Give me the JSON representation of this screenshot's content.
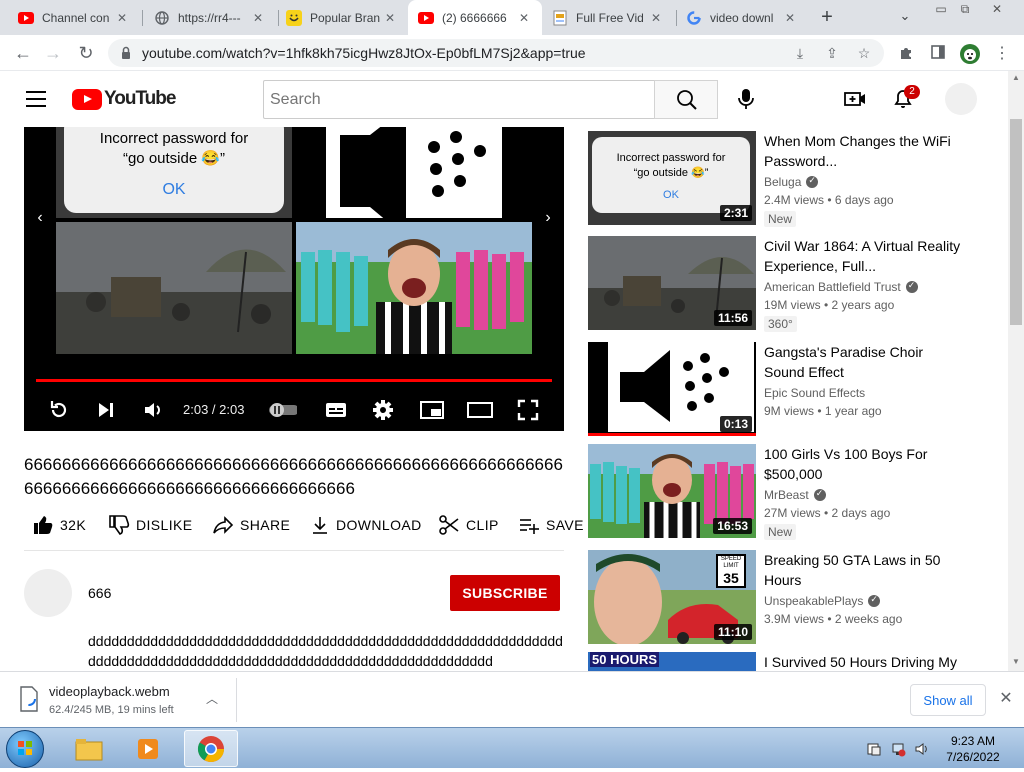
{
  "browser": {
    "tabs": [
      {
        "title": "Channel con",
        "favicon": "youtube-icon"
      },
      {
        "title": "https://rr4---",
        "favicon": "globe-icon"
      },
      {
        "title": "Popular Bran",
        "favicon": "smiley-icon"
      },
      {
        "title": "(2) 6666666",
        "favicon": "youtube-icon",
        "active": true
      },
      {
        "title": "Full Free Vid",
        "favicon": "document-icon"
      },
      {
        "title": "video downl",
        "favicon": "google-icon"
      }
    ],
    "url": "youtube.com/watch?v=1hfk8kh75icgHwz8JtOx-Ep0bfLM7Sj2&app=true"
  },
  "youtube": {
    "logo_text": "YouTube",
    "search_placeholder": "Search",
    "notifications_count": "2"
  },
  "player": {
    "pw_card_line1": "Incorrect password for",
    "pw_card_line2": "“go outside 😂”",
    "pw_card_ok": "OK",
    "time": "2:03 / 2:03",
    "progress": 1.0
  },
  "video": {
    "title": "66666666666666666666666666666666666666666666666666666666666666666666666666666666666666666666",
    "actions": {
      "like": "32K",
      "dislike": "DISLIKE",
      "share": "SHARE",
      "download": "DOWNLOAD",
      "clip": "CLIP",
      "save": "SAVE"
    },
    "channel": "666",
    "subscribe": "SUBSCRIBE",
    "description": "ddddddddddddddddddddddddddddddddddddddddddddddddddddddddddddddddddddddddddddddddddddddddddddddddddddddddddddddddd"
  },
  "recommendations": [
    {
      "title": "When Mom Changes the WiFi Password...",
      "channel": "Beluga",
      "verified": true,
      "meta": "2.4M views • 6 days ago",
      "badge": "New",
      "duration": "2:31",
      "thumb_line1": "Incorrect password for",
      "thumb_line2": "“go outside 😂”",
      "thumb_ok": "OK"
    },
    {
      "title": "Civil War 1864: A Virtual Reality Experience, Full...",
      "channel": "American Battlefield Trust",
      "verified": true,
      "meta": "19M views • 2 years ago",
      "badge": "360°",
      "duration": "11:56"
    },
    {
      "title": "Gangsta's Paradise Choir Sound Effect",
      "channel": "Epic Sound Effects",
      "verified": false,
      "meta": "9M views • 1 year ago",
      "badge": "",
      "duration": "0:13"
    },
    {
      "title": "100 Girls Vs 100 Boys For $500,000",
      "channel": "MrBeast",
      "verified": true,
      "meta": "27M views • 2 days ago",
      "badge": "New",
      "duration": "16:53"
    },
    {
      "title": "Breaking 50 GTA Laws in 50 Hours",
      "channel": "UnspeakablePlays",
      "verified": true,
      "meta": "3.9M views • 2 weeks ago",
      "badge": "",
      "duration": "11:10",
      "sign_top": "SPEED LIMIT",
      "sign_num": "35"
    },
    {
      "title": "I Survived 50 Hours Driving My",
      "channel": "",
      "verified": false,
      "meta": "",
      "badge": "",
      "duration": "",
      "thumb_text": "50 HOURS"
    }
  ],
  "download": {
    "filename": "videoplayback.webm",
    "status": "62.4/245 MB, 19 mins left",
    "show_all": "Show all"
  },
  "taskbar": {
    "time": "9:23 AM",
    "date": "7/26/2022"
  }
}
